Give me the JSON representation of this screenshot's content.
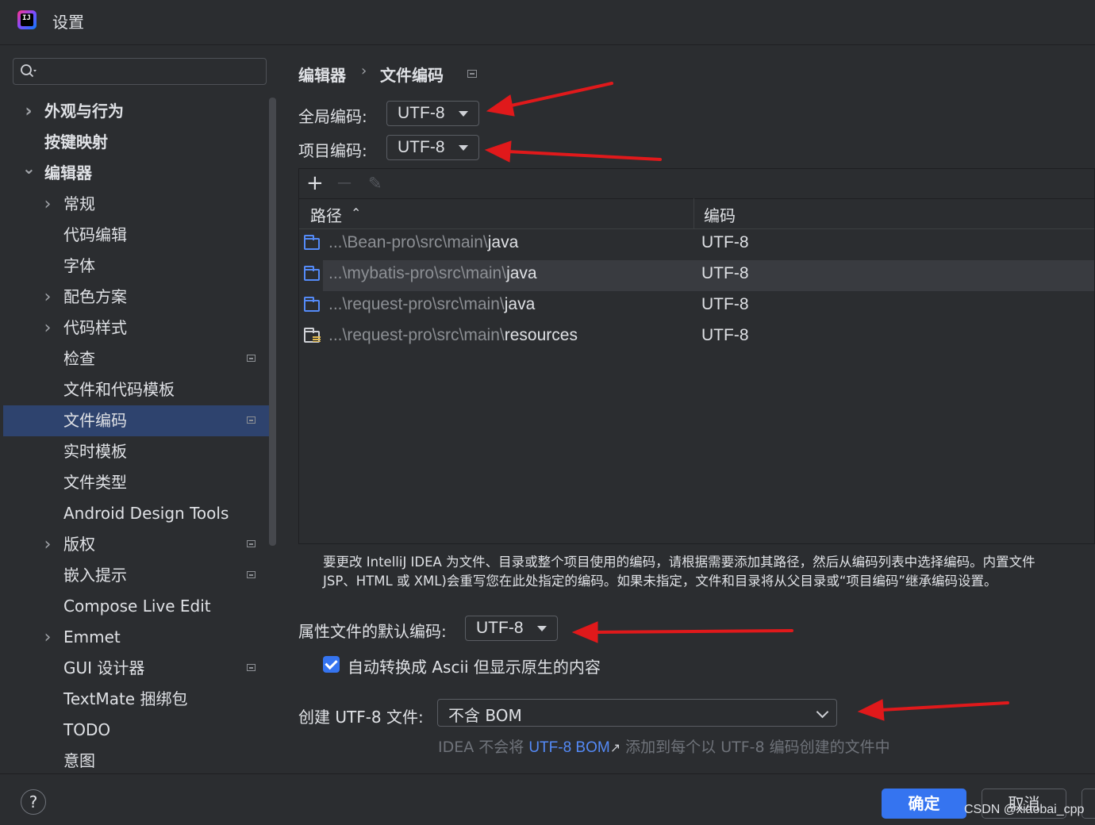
{
  "window": {
    "title": "设置"
  },
  "sidebar": {
    "items": [
      {
        "label": "外观与行为",
        "level": 0,
        "expander": "collapsed",
        "bold": true,
        "settings_icon": false,
        "selected": false
      },
      {
        "label": "按键映射",
        "level": 0,
        "expander": "none",
        "bold": true,
        "settings_icon": false,
        "selected": false
      },
      {
        "label": "编辑器",
        "level": 0,
        "expander": "expanded",
        "bold": true,
        "settings_icon": false,
        "selected": false
      },
      {
        "label": "常规",
        "level": 1,
        "expander": "collapsed",
        "bold": false,
        "settings_icon": false,
        "selected": false
      },
      {
        "label": "代码编辑",
        "level": 1,
        "expander": "none",
        "bold": false,
        "settings_icon": false,
        "selected": false
      },
      {
        "label": "字体",
        "level": 1,
        "expander": "none",
        "bold": false,
        "settings_icon": false,
        "selected": false
      },
      {
        "label": "配色方案",
        "level": 1,
        "expander": "collapsed",
        "bold": false,
        "settings_icon": false,
        "selected": false
      },
      {
        "label": "代码样式",
        "level": 1,
        "expander": "collapsed",
        "bold": false,
        "settings_icon": false,
        "selected": false
      },
      {
        "label": "检查",
        "level": 1,
        "expander": "none",
        "bold": false,
        "settings_icon": true,
        "selected": false
      },
      {
        "label": "文件和代码模板",
        "level": 1,
        "expander": "none",
        "bold": false,
        "settings_icon": false,
        "selected": false
      },
      {
        "label": "文件编码",
        "level": 1,
        "expander": "none",
        "bold": false,
        "settings_icon": true,
        "selected": true
      },
      {
        "label": "实时模板",
        "level": 1,
        "expander": "none",
        "bold": false,
        "settings_icon": false,
        "selected": false
      },
      {
        "label": "文件类型",
        "level": 1,
        "expander": "none",
        "bold": false,
        "settings_icon": false,
        "selected": false
      },
      {
        "label": "Android Design Tools",
        "level": 1,
        "expander": "none",
        "bold": false,
        "settings_icon": false,
        "selected": false
      },
      {
        "label": "版权",
        "level": 1,
        "expander": "collapsed",
        "bold": false,
        "settings_icon": true,
        "selected": false
      },
      {
        "label": "嵌入提示",
        "level": 1,
        "expander": "none",
        "bold": false,
        "settings_icon": true,
        "selected": false
      },
      {
        "label": "Compose Live Edit",
        "level": 1,
        "expander": "none",
        "bold": false,
        "settings_icon": false,
        "selected": false
      },
      {
        "label": "Emmet",
        "level": 1,
        "expander": "collapsed",
        "bold": false,
        "settings_icon": false,
        "selected": false
      },
      {
        "label": "GUI 设计器",
        "level": 1,
        "expander": "none",
        "bold": false,
        "settings_icon": true,
        "selected": false
      },
      {
        "label": "TextMate 捆绑包",
        "level": 1,
        "expander": "none",
        "bold": false,
        "settings_icon": false,
        "selected": false
      },
      {
        "label": "TODO",
        "level": 1,
        "expander": "none",
        "bold": false,
        "settings_icon": false,
        "selected": false
      },
      {
        "label": "意图",
        "level": 1,
        "expander": "none",
        "bold": false,
        "settings_icon": false,
        "selected": false
      }
    ]
  },
  "main": {
    "breadcrumb": {
      "parent": "编辑器",
      "separator": "›",
      "current": "文件编码"
    },
    "global_encoding": {
      "label": "全局编码:",
      "value": "UTF-8"
    },
    "project_encoding": {
      "label": "项目编码:",
      "value": "UTF-8"
    },
    "table": {
      "toolbar": {
        "add": "+",
        "remove": "—",
        "edit": "✎"
      },
      "columns": {
        "path": "路径",
        "sort_indicator": "⌃",
        "encoding": "编码"
      },
      "rows": [
        {
          "path_prefix": "...\\Bean-pro\\src\\main\\",
          "path_tail": "java",
          "encoding": "UTF-8",
          "icon": "folder-icon",
          "highlighted": false
        },
        {
          "path_prefix": "...\\mybatis-pro\\src\\main\\",
          "path_tail": "java",
          "encoding": "UTF-8",
          "icon": "folder-icon",
          "highlighted": true
        },
        {
          "path_prefix": "...\\request-pro\\src\\main\\",
          "path_tail": "java",
          "encoding": "UTF-8",
          "icon": "folder-icon",
          "highlighted": false
        },
        {
          "path_prefix": "...\\request-pro\\src\\main\\",
          "path_tail": "resources",
          "encoding": "UTF-8",
          "icon": "resources-folder-icon",
          "highlighted": false
        }
      ]
    },
    "note": {
      "line1": "要更改 IntelliJ IDEA 为文件、目录或整个项目使用的编码，请根据需要添加其路径，然后从编码列表中选择编码。内置文件",
      "line2": "JSP、HTML 或 XML)会重写您在此处指定的编码。如果未指定，文件和目录将从父目录或“项目编码”继承编码设置。"
    },
    "properties_encoding": {
      "label": "属性文件的默认编码:",
      "value": "UTF-8"
    },
    "ascii_checkbox": {
      "label": "自动转换成 Ascii 但显示原生的内容",
      "checked": true
    },
    "create_utf8": {
      "label": "创建 UTF-8 文件:",
      "value": "不含 BOM"
    },
    "hint": {
      "prefix": "IDEA 不会将 ",
      "link": "UTF-8 BOM",
      "link_icon": "↗",
      "suffix": " 添加到每个以 UTF-8 编码创建的文件中"
    }
  },
  "footer": {
    "help": "?",
    "ok": "确定",
    "cancel": "取消",
    "watermark": "CSDN @xiaobai_cpp"
  },
  "colors": {
    "background": "#2b2d30",
    "selection": "#2e436e",
    "accent": "#3574f0",
    "annotation_arrow": "#e0191b"
  }
}
